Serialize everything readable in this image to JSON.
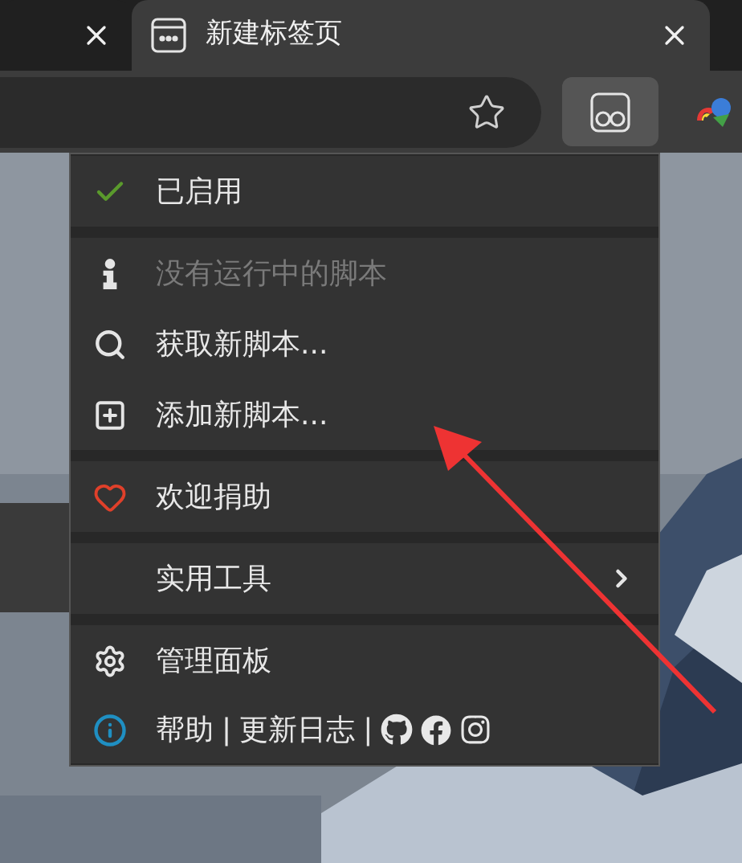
{
  "tabs": [
    {
      "selected": false
    },
    {
      "label": "新建标签页",
      "selected": true
    }
  ],
  "menu": {
    "sections": [
      [
        {
          "kind": "toggle",
          "label": "已启用",
          "checked": true
        }
      ],
      [
        {
          "kind": "info",
          "label": "没有运行中的脚本",
          "disabled": true
        },
        {
          "kind": "search",
          "label": "获取新脚本...",
          "disabled": false
        },
        {
          "kind": "add",
          "label": "添加新脚本...",
          "disabled": false
        }
      ],
      [
        {
          "kind": "donate",
          "label": "欢迎捐助"
        }
      ],
      [
        {
          "kind": "submenu",
          "label": "实用工具"
        }
      ],
      [
        {
          "kind": "dashboard",
          "label": "管理面板"
        },
        {
          "kind": "links",
          "parts": [
            "帮助",
            "|",
            "更新日志",
            "|"
          ]
        }
      ]
    ]
  }
}
